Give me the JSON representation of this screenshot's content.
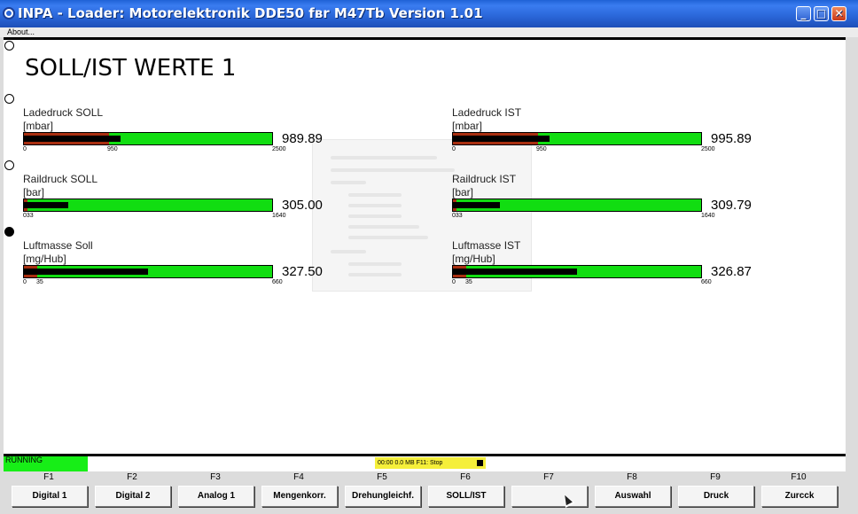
{
  "window": {
    "title": "INPA - Loader:  Motorelektronik DDE50 fвr M47Tb Version 1.01"
  },
  "menu": {
    "about": "About..."
  },
  "page": {
    "title": "SOLL/IST WERTE 1"
  },
  "gauges": [
    {
      "name": "Ladedruck SOLL",
      "unit": "[mbar]",
      "value": "989.89",
      "min": "0",
      "mid": "950",
      "max": "2500",
      "fill_pct": 39
    },
    {
      "name": "Ladedruck IST",
      "unit": "[mbar]",
      "value": "995.89",
      "min": "0",
      "mid": "950",
      "max": "2500",
      "fill_pct": 39
    },
    {
      "name": "Raildruck SOLL",
      "unit": "[bar]",
      "value": "305.00",
      "min": "033",
      "max": "1640",
      "fill_pct": 18
    },
    {
      "name": "Raildruck IST",
      "unit": "[bar]",
      "value": "309.79",
      "min": "033",
      "max": "1640",
      "fill_pct": 19
    },
    {
      "name": "Luftmasse Soll",
      "unit": "[mg/Hub]",
      "value": "327.50",
      "min": "0",
      "mid": "35",
      "max": "660",
      "fill_pct": 50
    },
    {
      "name": "Luftmasse IST",
      "unit": "[mg/Hub]",
      "value": "326.87",
      "min": "0",
      "mid": "35",
      "max": "660",
      "fill_pct": 50
    }
  ],
  "status": {
    "running": "RUNNING",
    "memory": "00:00   0.0 MB   F11: Stop"
  },
  "function_keys": [
    {
      "key": "F1",
      "label": "Digital 1"
    },
    {
      "key": "F2",
      "label": "Digital 2"
    },
    {
      "key": "F3",
      "label": "Analog 1"
    },
    {
      "key": "F4",
      "label": "Mengenkorr."
    },
    {
      "key": "F5",
      "label": "Drehungleichf."
    },
    {
      "key": "F6",
      "label": "SOLL/IST"
    },
    {
      "key": "F7",
      "label": ""
    },
    {
      "key": "F8",
      "label": "Auswahl"
    },
    {
      "key": "F9",
      "label": "Druck"
    },
    {
      "key": "F10",
      "label": "Zurсck"
    }
  ],
  "colors": {
    "bar": "#11dd11",
    "fill": "#000000",
    "marker": "#c31010",
    "status": "#17ee17",
    "memory": "#f5ef3a"
  }
}
